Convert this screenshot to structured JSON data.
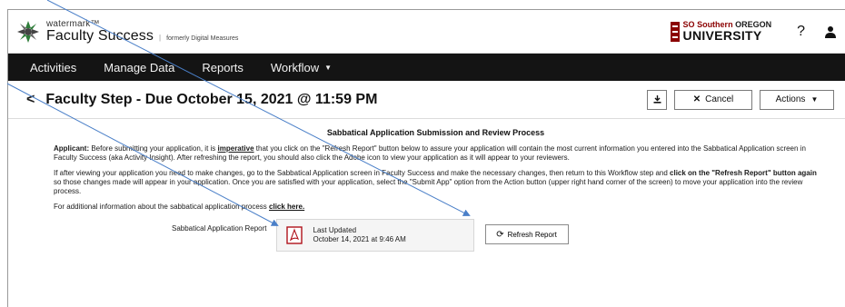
{
  "header": {
    "brand_small": "watermark™",
    "brand_main": "Faculty Success",
    "brand_sep": "|",
    "brand_formerly": "formerly Digital Measures",
    "university_top_a": "SO",
    "university_top_b": "Southern",
    "university_top_c": "OREGON",
    "university_bottom": "UNIVERSITY",
    "help": "?"
  },
  "nav": {
    "items": [
      "Activities",
      "Manage Data",
      "Reports",
      "Workflow"
    ]
  },
  "titlebar": {
    "back": "<",
    "title": "Faculty Step - Due October 15, 2021 @ 11:59 PM",
    "cancel": "Cancel",
    "actions": "Actions"
  },
  "content": {
    "section_title": "Sabbatical Application Submission and Review Process",
    "p1_a": "Applicant:",
    "p1_b": " Before submitting your application, it is ",
    "p1_c": "imperative",
    "p1_d": " that you click on the \"Refresh Report\" button below to assure your application will contain the most current information you entered into the Sabbatical Application screen in Faculty Success (aka Activity Insight). After refreshing the report, you should also click the Adobe icon to view your application as it will appear to your reviewers.",
    "p2_a": "If after viewing your application you need to make changes, go to the Sabbatical Application screen in Faculty Success and make the necessary changes, then return to this Workflow step and ",
    "p2_b": "click on the \"Refresh Report\" button again",
    "p2_c": " so those changes made will appear in your application.  Once you are satisfied with your application, select the \"Submit App\" option from the Action button (upper right hand corner of the screen) to move your application into the review process.",
    "p3_a": "For additional information about the sabbatical application process ",
    "p3_link": "click here.",
    "report_label": "Sabbatical Application Report",
    "last_updated_label": "Last Updated",
    "last_updated_value": "October 14, 2021 at 9:46 AM",
    "refresh_button": "Refresh Report"
  },
  "colors": {
    "nav_bg": "#141414",
    "pdf_red": "#b0121b",
    "arrow_blue": "#4a7fc8",
    "brand_red": "#8b0000"
  }
}
